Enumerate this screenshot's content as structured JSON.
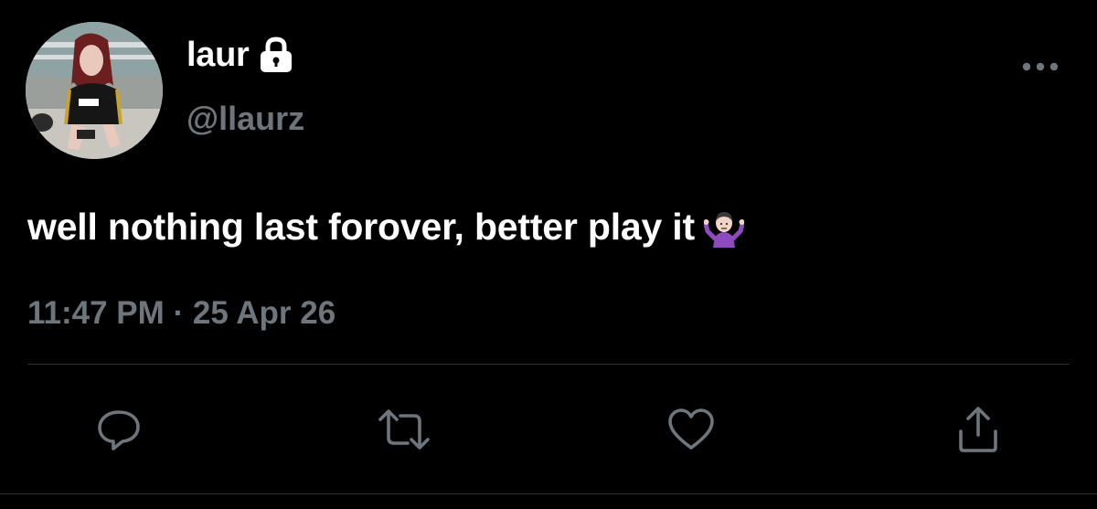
{
  "tweet": {
    "author": {
      "display_name": "laur",
      "handle": "@llaurz",
      "protected_icon": "lock-icon",
      "avatar_icon": "profile-photo"
    },
    "text": "well nothing last forover, better play it",
    "emoji_icon": "person-shrugging-emoji",
    "timestamp": "11:47 PM · 25 Apr 26"
  },
  "actions": [
    {
      "name": "reply",
      "icon": "reply-icon"
    },
    {
      "name": "retweet",
      "icon": "retweet-icon"
    },
    {
      "name": "like",
      "icon": "heart-icon"
    },
    {
      "name": "share",
      "icon": "share-icon"
    }
  ],
  "more_icon": "more-icon",
  "colors": {
    "background": "#000000",
    "primary_text": "#ffffff",
    "secondary_text": "#6e767d",
    "divider": "#2f3336"
  }
}
